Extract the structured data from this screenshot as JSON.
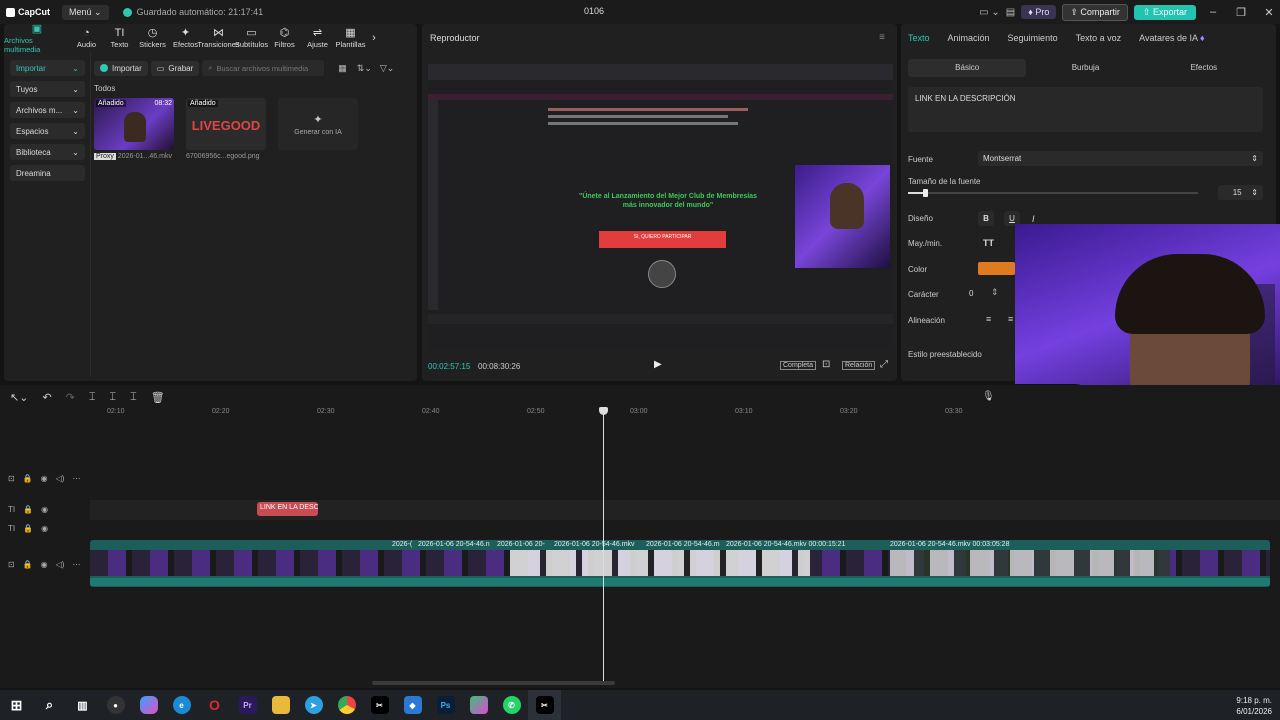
{
  "titlebar": {
    "logo": "CapCut",
    "menu": "Menú",
    "autosave": "Guardado automático: 21:17:41",
    "project": "0106",
    "pro": "Pro",
    "share": "Compartir",
    "export": "Exportar"
  },
  "toolbar": [
    {
      "label": "Archivos multimedia",
      "icon": "media-icon"
    },
    {
      "label": "Audio",
      "icon": "audio-icon"
    },
    {
      "label": "Texto",
      "icon": "text-icon"
    },
    {
      "label": "Stickers",
      "icon": "sticker-icon"
    },
    {
      "label": "Efectos",
      "icon": "effects-icon"
    },
    {
      "label": "Transiciones",
      "icon": "transition-icon"
    },
    {
      "label": "Subtítulos",
      "icon": "subtitle-icon"
    },
    {
      "label": "Filtros",
      "icon": "filter-icon"
    },
    {
      "label": "Ajuste",
      "icon": "adjust-icon"
    },
    {
      "label": "Plantillas",
      "icon": "template-icon"
    }
  ],
  "sidenav": [
    "Importar",
    "Tuyos",
    "Archivos m...",
    "Espacios",
    "Biblioteca",
    "Dreamina"
  ],
  "media": {
    "import": "Importar",
    "record": "Grabar",
    "search_placeholder": "Buscar archivos multimedia",
    "all": "Todos",
    "items": [
      {
        "badge": "Añadido",
        "duration": "08:32",
        "name": "2026-01...46.mkv",
        "tag": "Proxy"
      },
      {
        "badge": "Añadido",
        "duration": "",
        "name": "67006956c...egood.png",
        "logo": "LIVEGOOD"
      }
    ],
    "generate": "Generar con IA"
  },
  "player": {
    "title": "Reproductor",
    "current": "00:02:57:15",
    "total": "00:08:30:26",
    "full": "Completa",
    "ratio": "Relación",
    "page_headline": "\"Únete al Lanzamiento del Mejor Club de Membresías más innovador del mundo\"",
    "page_cta": "SI, QUIERO PARTICIPAR"
  },
  "props": {
    "tabs": [
      "Texto",
      "Animación",
      "Seguimiento",
      "Texto a voz",
      "Avatares de IA"
    ],
    "subtabs": [
      "Básico",
      "Burbuja",
      "Efectos"
    ],
    "text_value": "LINK EN LA DESCRIPCIÓN",
    "font_label": "Fuente",
    "font_value": "Montserrat",
    "size_label": "Tamaño de la fuente",
    "size_value": "15",
    "size_level": 0.05,
    "design_label": "Diseño",
    "case_label": "May./min.",
    "case_value": "TT",
    "color_label": "Color",
    "color_value": "#e07a1f",
    "char_label": "Carácter",
    "char_value": "0",
    "align_label": "Alineación",
    "preset_label": "Estilo preestablecido"
  },
  "timeline": {
    "ticks": [
      "02:10",
      "02:20",
      "02:30",
      "02:40",
      "02:50",
      "03:00",
      "03:10",
      "03:20",
      "03:30"
    ],
    "text_clip": "LINK EN LA DESCR",
    "clip_labels": [
      "2026-(",
      "2026-01-06 20-54-46.n",
      "2026-01-06 20-",
      "2026-01-06 20-54-46.mkv",
      "2026-01-06 20-54-46.m",
      "2026-01-06 20-54-46.mkv  00:00:15:21",
      "2026-01-06 20-54-46.mkv  00:03:05:28"
    ]
  },
  "clock": {
    "time": "9:18 p. m.",
    "date": "6/01/2026"
  }
}
